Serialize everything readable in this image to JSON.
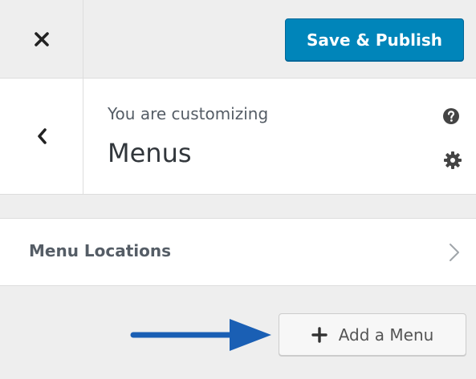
{
  "header": {
    "close_icon": "close-icon",
    "save_label": "Save & Publish",
    "accent_color": "#0085ba"
  },
  "info": {
    "back_icon": "chevron-left-icon",
    "customizing_label": "You are customizing",
    "panel_title": "Menus",
    "help_icon": "help-icon",
    "settings_icon": "gear-icon"
  },
  "sections": [
    {
      "title": "Menu Locations",
      "icon": "chevron-right-icon"
    }
  ],
  "actions": {
    "add_menu_label": "Add a Menu",
    "add_menu_icon": "plus-icon",
    "annotation_arrow_color": "#1a5fb4"
  }
}
